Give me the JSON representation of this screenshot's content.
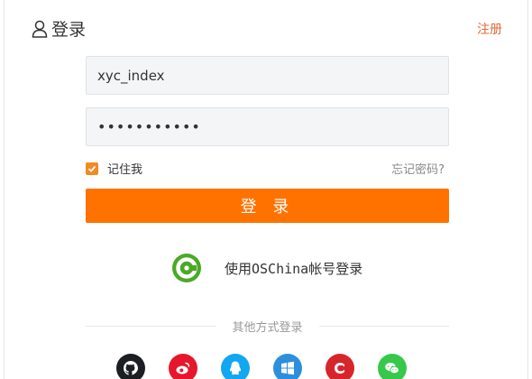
{
  "header": {
    "title": "登录",
    "register_label": "注册"
  },
  "form": {
    "username": {
      "value": "xyc_index"
    },
    "password": {
      "value": "•••••••••••"
    },
    "remember": {
      "label": "记住我",
      "checked": true
    },
    "forgot_label": "忘记密码?",
    "login_label": "登 录"
  },
  "oschina": {
    "label": "使用OSChina帐号登录",
    "icon": "oschina-logo-icon"
  },
  "other": {
    "divider_label": "其他方式登录",
    "providers": [
      {
        "name": "github-icon",
        "color": "#1b1f23"
      },
      {
        "name": "weibo-icon",
        "color": "#e6162d"
      },
      {
        "name": "qq-icon",
        "color": "#12a7f0"
      },
      {
        "name": "windows-icon",
        "color": "#2d8fdc"
      },
      {
        "name": "csdn-icon",
        "color": "#d6262b"
      },
      {
        "name": "wechat-icon",
        "color": "#35c84a"
      }
    ]
  },
  "colors": {
    "accent": "#ff7200",
    "link": "#e06a3a",
    "checkbox": "#f28a24"
  }
}
